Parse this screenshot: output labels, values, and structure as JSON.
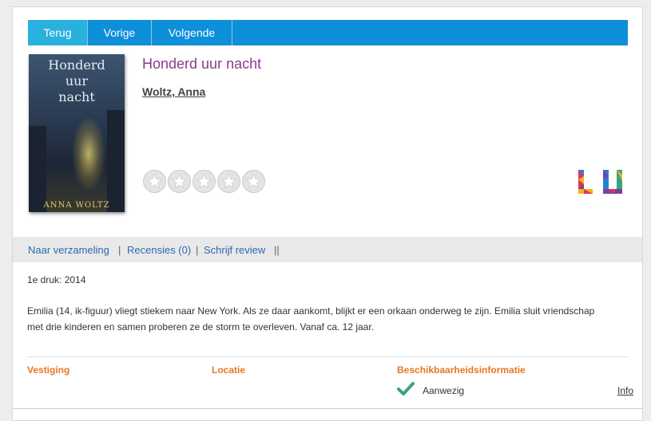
{
  "nav": {
    "back_label": "Terug",
    "prev_label": "Vorige",
    "next_label": "Volgende"
  },
  "book": {
    "title": "Honderd uur nacht",
    "author": "Woltz, Anna",
    "cover": {
      "title_line1": "Honderd",
      "title_line2": "uur",
      "title_line3": "nacht",
      "author": "ANNA WOLTZ"
    },
    "rating": {
      "stars_total": 5,
      "stars_filled": 0
    },
    "logo_text": "LU"
  },
  "links": {
    "to_collection": "Naar verzameling",
    "reviews": "Recensies (0)",
    "write_review": "Schrijf review",
    "separator": "|",
    "end_separator": "||"
  },
  "details": {
    "edition": "1e druk: 2014",
    "summary": "Emilia (14, ik-figuur) vliegt stiekem naar New York. Als ze daar aankomt, blijkt er een orkaan onderweg te zijn. Emilia sluit vriendschap met drie kinderen en samen proberen ze de storm te overleven. Vanaf ca. 12 jaar."
  },
  "availability": {
    "headers": {
      "branch": "Vestiging",
      "location": "Locatie",
      "info": "Beschikbaarheidsinformatie"
    },
    "status_icon": "checkmark-icon",
    "status": "Aanwezig",
    "info_link": "Info"
  },
  "colors": {
    "nav_bar": "#0d8fd9",
    "nav_active": "#2ab0dd",
    "title": "#8b3a8f",
    "header_orange": "#e87722",
    "link_blue": "#2a6ab0",
    "check_green": "#3aa57a"
  }
}
